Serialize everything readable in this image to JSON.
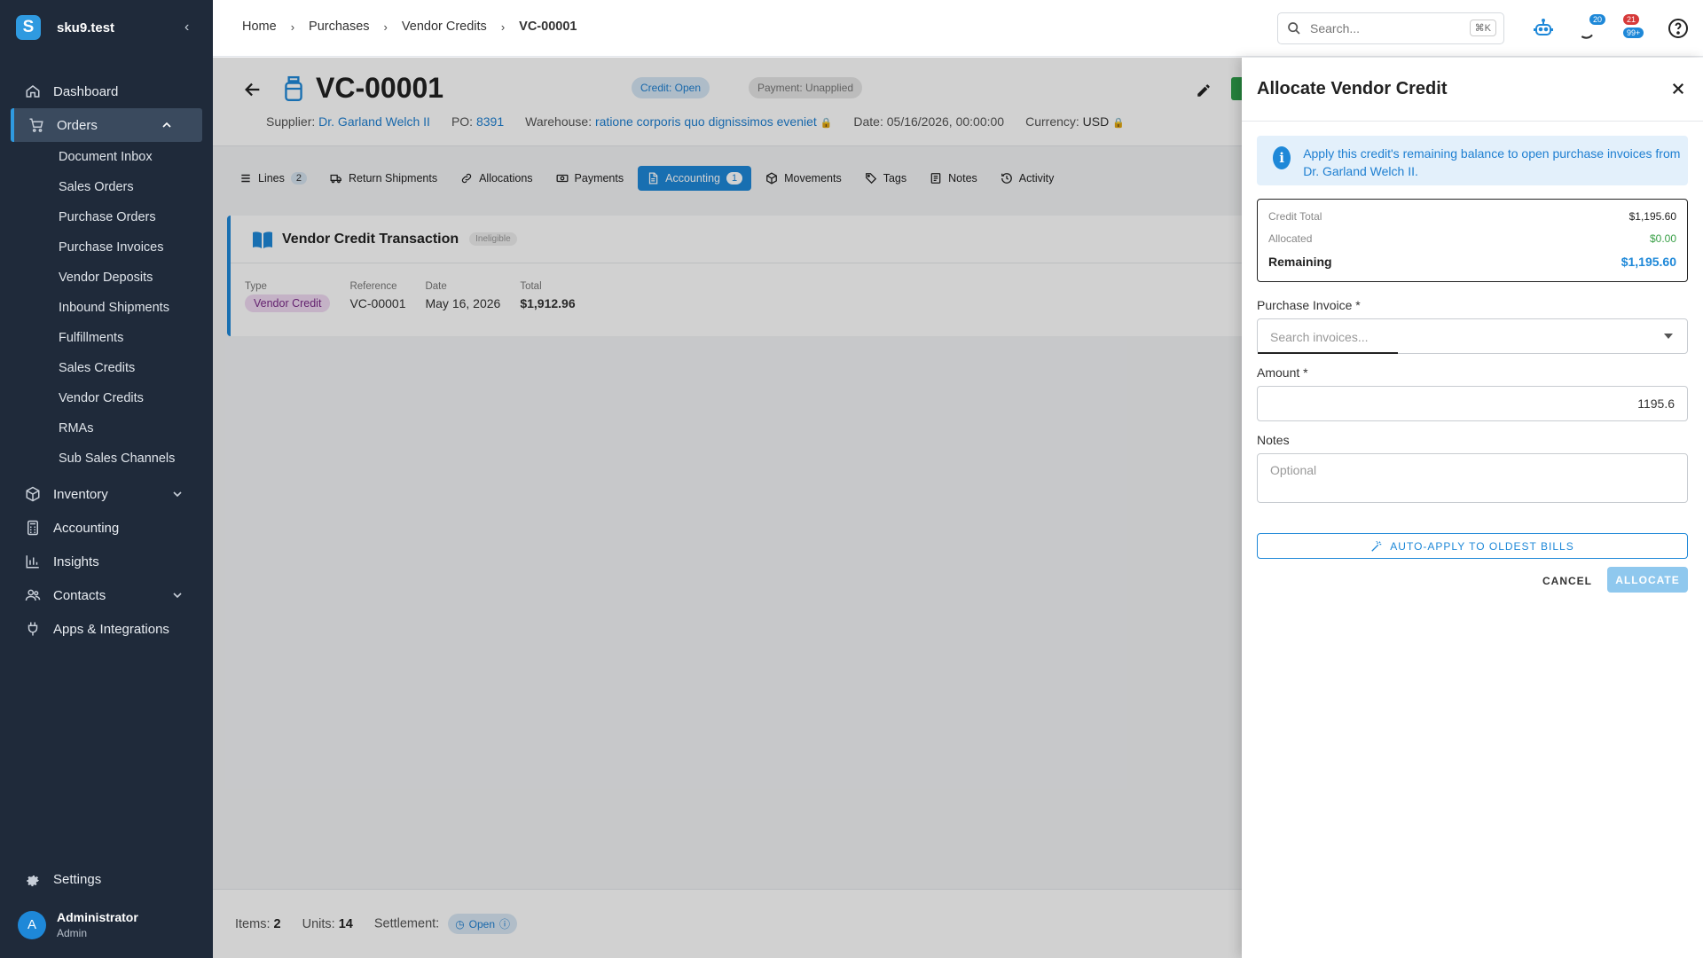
{
  "app": {
    "name": "sku9.test",
    "logo_letter": "S"
  },
  "sidebar": {
    "nav": [
      {
        "label": "Dashboard",
        "icon": "home-icon"
      },
      {
        "label": "Orders",
        "icon": "cart-icon",
        "expanded": true,
        "children": [
          "Document Inbox",
          "Sales Orders",
          "Purchase Orders",
          "Purchase Invoices",
          "Vendor Deposits",
          "Inbound Shipments",
          "Fulfillments",
          "Sales Credits",
          "Vendor Credits",
          "RMAs",
          "Sub Sales Channels"
        ]
      },
      {
        "label": "Inventory",
        "icon": "box-icon"
      },
      {
        "label": "Accounting",
        "icon": "calculator-icon"
      },
      {
        "label": "Insights",
        "icon": "bar-chart-icon"
      },
      {
        "label": "Contacts",
        "icon": "people-icon"
      },
      {
        "label": "Apps & Integrations",
        "icon": "plug-icon"
      }
    ],
    "settings": "Settings",
    "user": {
      "initial": "A",
      "name": "Administrator",
      "role": "Admin"
    }
  },
  "topbar": {
    "breadcrumbs": [
      "Home",
      "Purchases",
      "Vendor Credits",
      "VC-00001"
    ],
    "search_placeholder": "Search...",
    "search_shortcut": "⌘K",
    "badges": {
      "tasks": "20",
      "notifications_top": "21",
      "notifications_bottom": "99+"
    }
  },
  "header": {
    "title": "VC-00001",
    "credit_status": "Credit: Open",
    "payment_status": "Payment: Unapplied",
    "supplier_label": "Supplier:",
    "supplier": "Dr. Garland Welch II",
    "po_label": "PO:",
    "po": "8391",
    "warehouse_label": "Warehouse:",
    "warehouse": "ratione corporis quo dignissimos eveniet",
    "date": "Date: 05/16/2026, 00:00:00",
    "currency_label": "Currency:",
    "currency": "USD"
  },
  "tabs": [
    {
      "label": "Lines",
      "count": "2",
      "icon": "list-icon"
    },
    {
      "label": "Return Shipments",
      "icon": "truck-icon"
    },
    {
      "label": "Allocations",
      "icon": "link-icon"
    },
    {
      "label": "Payments",
      "icon": "money-icon"
    },
    {
      "label": "Accounting",
      "count": "1",
      "icon": "document-icon",
      "active": true
    },
    {
      "label": "Movements",
      "icon": "cube-icon"
    },
    {
      "label": "Tags",
      "icon": "tag-icon"
    },
    {
      "label": "Notes",
      "icon": "note-icon"
    },
    {
      "label": "Activity",
      "icon": "history-icon"
    }
  ],
  "transaction": {
    "title": "Vendor Credit Transaction",
    "status": "Ineligible",
    "fields": {
      "type_label": "Type",
      "type": "Vendor Credit",
      "reference_label": "Reference",
      "reference": "VC-00001",
      "date_label": "Date",
      "date": "May 16, 2026",
      "total_label": "Total",
      "total": "$1,912.96"
    }
  },
  "footer": {
    "items_label": "Items:",
    "items": "2",
    "units_label": "Units:",
    "units": "14",
    "settlement_label": "Settlement:",
    "settlement": "Open"
  },
  "drawer": {
    "title": "Allocate Vendor Credit",
    "info_prefix": "Apply this credit's remaining balance to open purchase invoices from ",
    "info_supplier": "Dr. Garland Welch II",
    "info_suffix": ".",
    "summary": {
      "credit_total_label": "Credit Total",
      "credit_total": "$1,195.60",
      "allocated_label": "Allocated",
      "allocated": "$0.00",
      "remaining_label": "Remaining",
      "remaining": "$1,195.60"
    },
    "invoice_label": "Purchase Invoice *",
    "invoice_placeholder": "Search invoices...",
    "amount_label": "Amount *",
    "amount_value": "1195.6",
    "notes_label": "Notes",
    "notes_placeholder": "Optional",
    "auto_apply": "AUTO-APPLY TO OLDEST BILLS",
    "cancel": "CANCEL",
    "allocate": "ALLOCATE"
  },
  "colors": {
    "sidebar": "#1f2a3a",
    "accent": "#1e88d8",
    "success": "#2e9e4a"
  }
}
